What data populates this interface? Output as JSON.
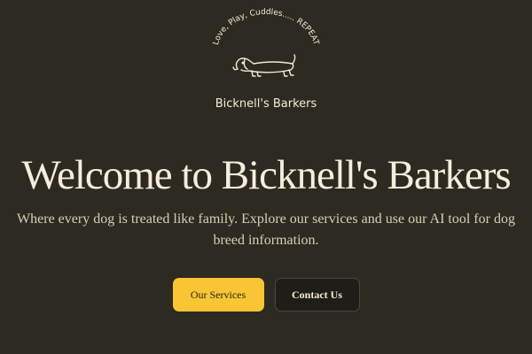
{
  "logo": {
    "tagline": "Love, Play, Cuddles..... REPEAT",
    "brand_name": "Bicknell's Barkers",
    "icon": "dachshund-icon"
  },
  "hero": {
    "title": "Welcome to Bicknell's Barkers",
    "subtitle": "Where every dog is treated like family. Explore our services and use our AI tool for dog breed information."
  },
  "actions": {
    "primary_label": "Our Services",
    "secondary_label": "Contact Us"
  },
  "colors": {
    "background": "#2d2a21",
    "accent": "#f9c535",
    "text": "#f4ecd8"
  }
}
